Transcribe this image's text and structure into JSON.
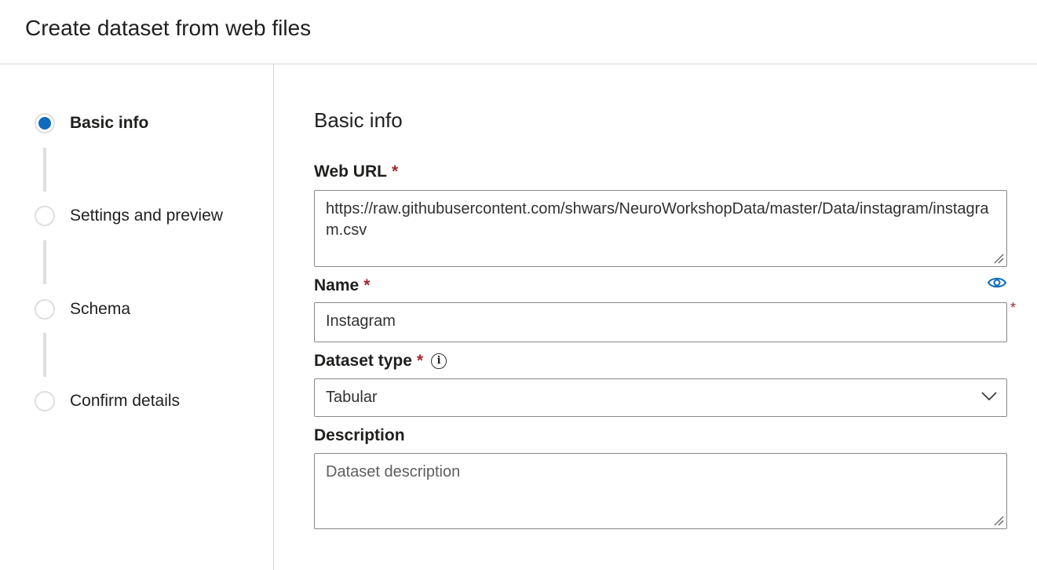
{
  "header": {
    "title": "Create dataset from web files"
  },
  "stepper": {
    "steps": [
      {
        "label": "Basic info",
        "active": true
      },
      {
        "label": "Settings and preview",
        "active": false
      },
      {
        "label": "Schema",
        "active": false
      },
      {
        "label": "Confirm details",
        "active": false
      }
    ]
  },
  "form": {
    "section_title": "Basic info",
    "required_mark": "*",
    "web_url": {
      "label": "Web URL",
      "value": "https://raw.githubusercontent.com/shwars/NeuroWorkshopData/master/Data/instagram/instagram.csv"
    },
    "name": {
      "label": "Name",
      "value": "Instagram"
    },
    "dataset_type": {
      "label": "Dataset type",
      "value": "Tabular",
      "info_icon": "info-icon"
    },
    "description": {
      "label": "Description",
      "placeholder": "Dataset description",
      "value": ""
    }
  },
  "colors": {
    "accent": "#0f6cbd",
    "required": "#a4262c",
    "border": "#8a8886",
    "divider": "#d6d6d6"
  },
  "icons": [
    "info-icon",
    "eye-icon",
    "chevron-down-icon",
    "resize-grip-icon"
  ]
}
